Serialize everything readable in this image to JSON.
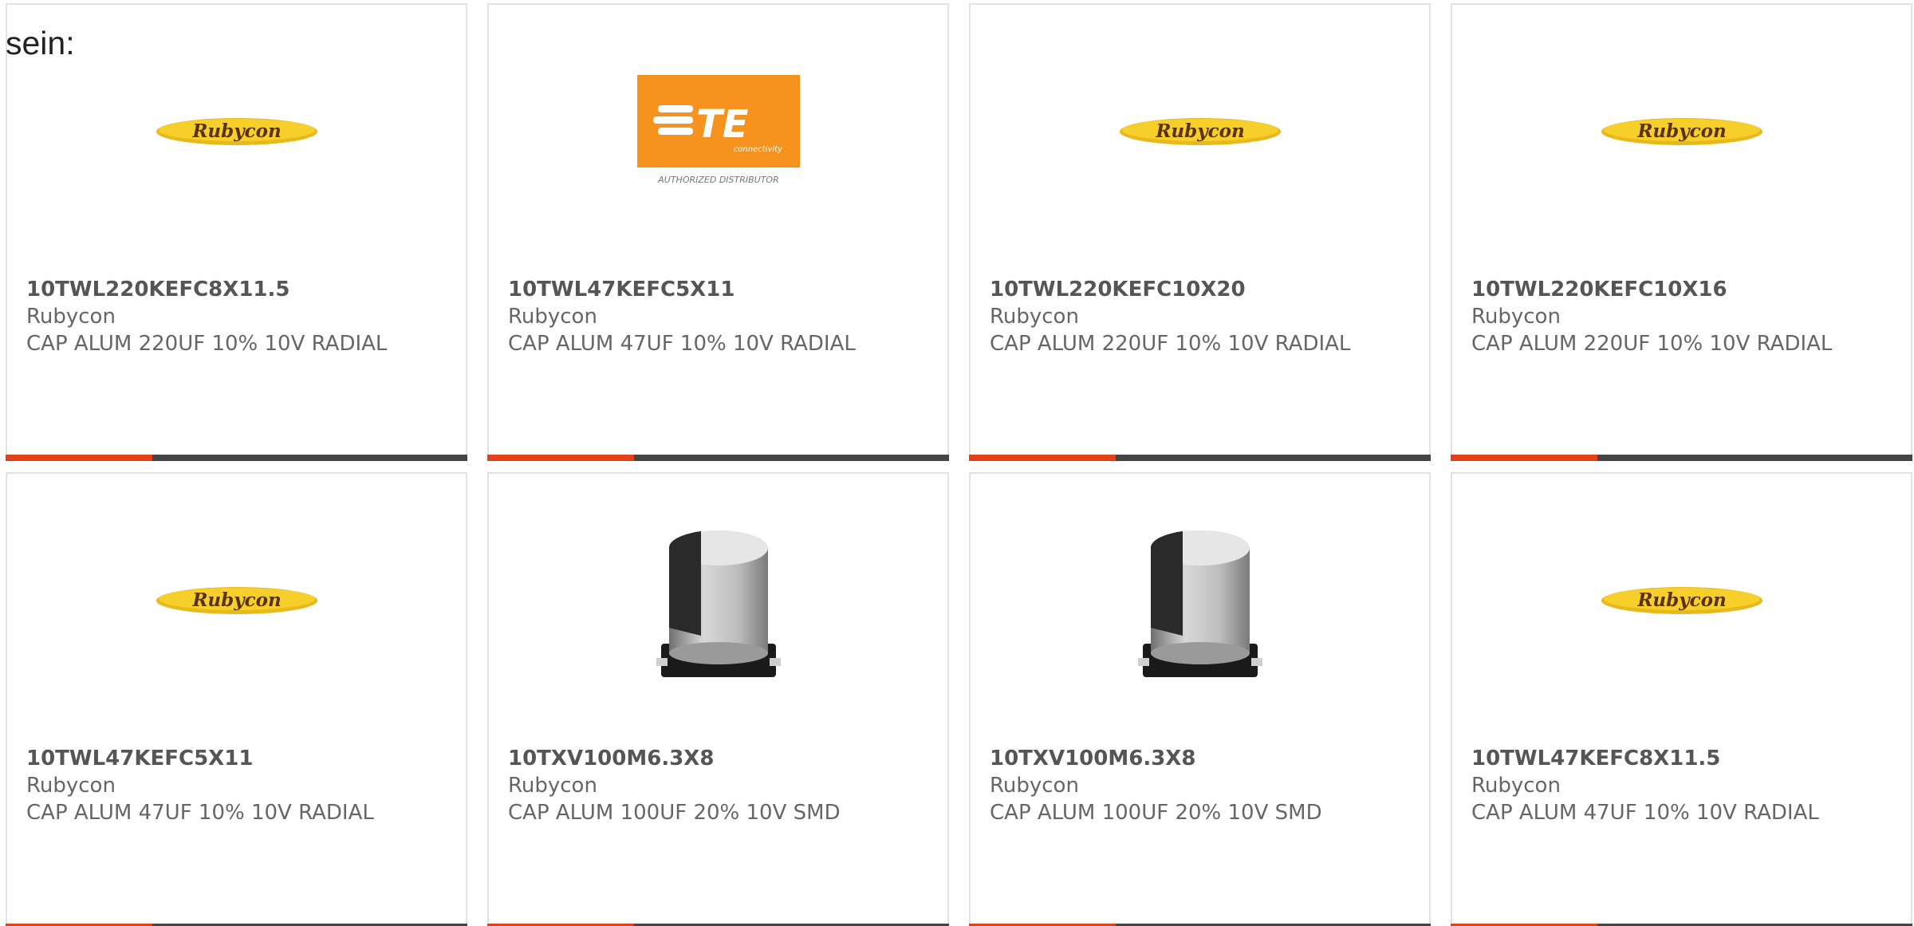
{
  "intro_text": "sein:",
  "colors": {
    "accent": "#e0401a",
    "bar": "#444444",
    "border": "#e2e2e2",
    "text": "#666666"
  },
  "products": [
    {
      "part_number": "10TWL220KEFC8X11.5",
      "manufacturer": "Rubycon",
      "description": "CAP ALUM 220UF 10% 10V RADIAL",
      "image": "rubycon-logo",
      "logo_text": "Rubycon"
    },
    {
      "part_number": "10TWL47KEFC5X11",
      "manufacturer": "Rubycon",
      "description": "CAP ALUM 47UF 10% 10V RADIAL",
      "image": "te-connectivity-logo",
      "logo_text": "TE",
      "logo_subtext": "connectivity",
      "logo_caption": "AUTHORIZED DISTRIBUTOR"
    },
    {
      "part_number": "10TWL220KEFC10X20",
      "manufacturer": "Rubycon",
      "description": "CAP ALUM 220UF 10% 10V RADIAL",
      "image": "rubycon-logo",
      "logo_text": "Rubycon"
    },
    {
      "part_number": "10TWL220KEFC10X16",
      "manufacturer": "Rubycon",
      "description": "CAP ALUM 220UF 10% 10V RADIAL",
      "image": "rubycon-logo",
      "logo_text": "Rubycon"
    },
    {
      "part_number": "10TWL47KEFC5X11",
      "manufacturer": "Rubycon",
      "description": "CAP ALUM 47UF 10% 10V RADIAL",
      "image": "rubycon-logo",
      "logo_text": "Rubycon"
    },
    {
      "part_number": "10TXV100M6.3X8",
      "manufacturer": "Rubycon",
      "description": "CAP ALUM 100UF 20% 10V SMD",
      "image": "smd-capacitor-photo"
    },
    {
      "part_number": "10TXV100M6.3X8",
      "manufacturer": "Rubycon",
      "description": "CAP ALUM 100UF 20% 10V SMD",
      "image": "smd-capacitor-photo"
    },
    {
      "part_number": "10TWL47KEFC8X11.5",
      "manufacturer": "Rubycon",
      "description": "CAP ALUM 47UF 10% 10V RADIAL",
      "image": "rubycon-logo",
      "logo_text": "Rubycon"
    }
  ]
}
